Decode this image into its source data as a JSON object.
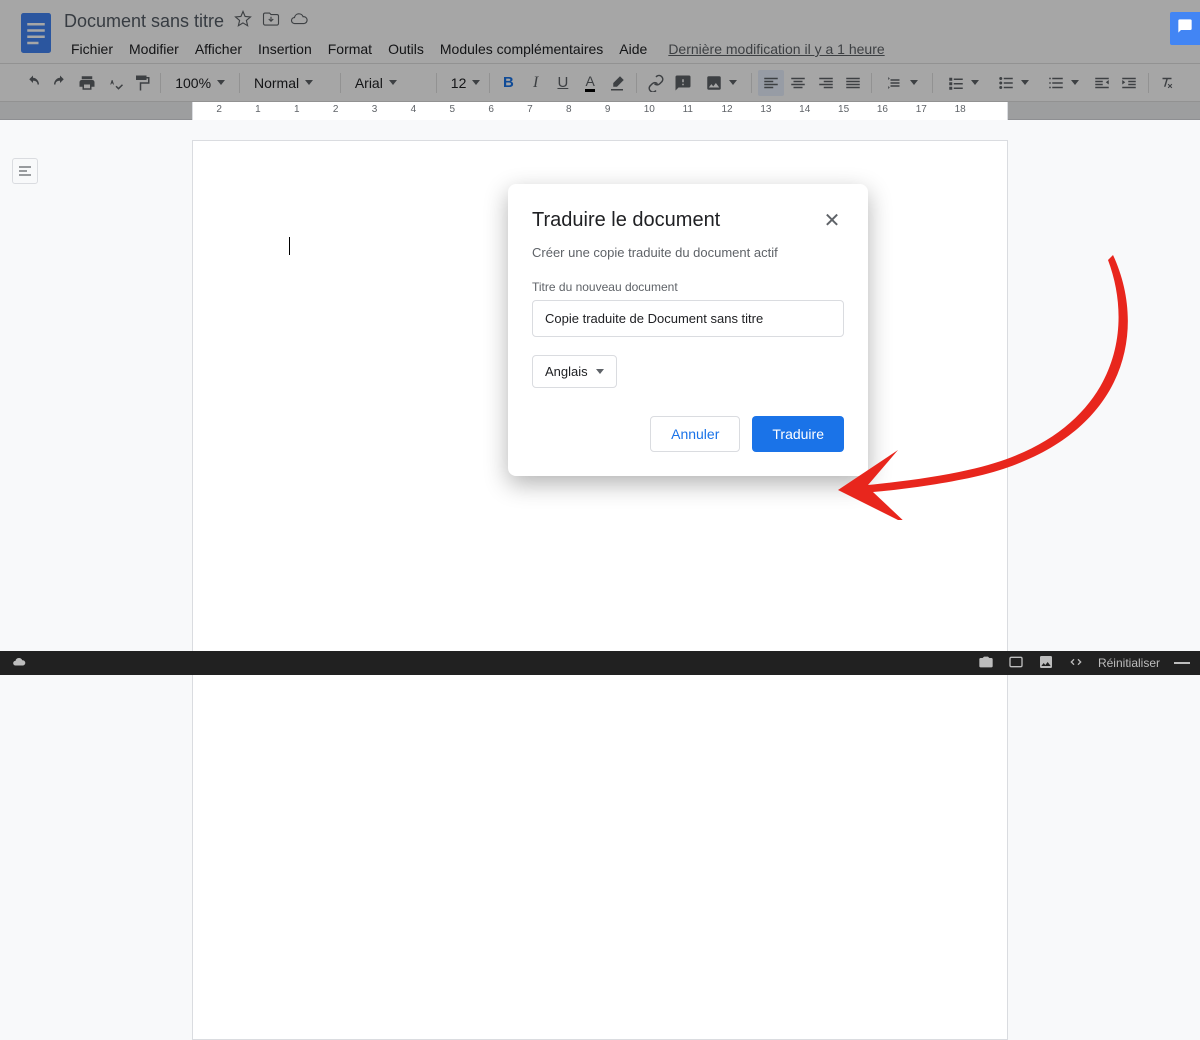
{
  "header": {
    "title": "Document sans titre",
    "lastModified": "Dernière modification il y a 1 heure"
  },
  "menu": {
    "file": "Fichier",
    "edit": "Modifier",
    "view": "Afficher",
    "insert": "Insertion",
    "format": "Format",
    "tools": "Outils",
    "addons": "Modules complémentaires",
    "help": "Aide"
  },
  "toolbar": {
    "zoom": "100%",
    "style": "Normal",
    "font": "Arial",
    "fontSize": "12",
    "bold": "B",
    "italic": "I",
    "underline": "U",
    "textColor": "A"
  },
  "ruler": {
    "ticks": [
      "2",
      "1",
      "1",
      "2",
      "3",
      "4",
      "5",
      "6",
      "7",
      "8",
      "9",
      "10",
      "11",
      "12",
      "13",
      "14",
      "15",
      "16",
      "17",
      "18"
    ]
  },
  "dialog": {
    "title": "Traduire le document",
    "subtitle": "Créer une copie traduite du document actif",
    "fieldLabel": "Titre du nouveau document",
    "fieldValue": "Copie traduite de Document sans titre",
    "language": "Anglais",
    "cancel": "Annuler",
    "confirm": "Traduire"
  },
  "footer": {
    "reset": "Réinitialiser"
  }
}
